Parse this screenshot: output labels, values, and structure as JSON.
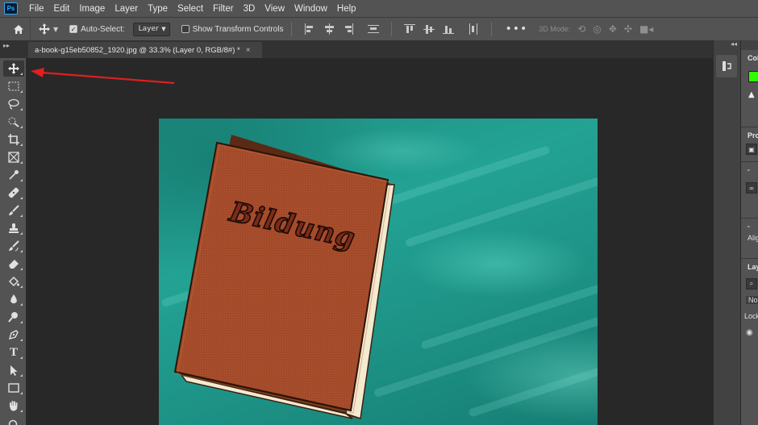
{
  "app": {
    "logo": "Ps"
  },
  "menu": [
    "File",
    "Edit",
    "Image",
    "Layer",
    "Type",
    "Select",
    "Filter",
    "3D",
    "View",
    "Window",
    "Help"
  ],
  "options": {
    "auto_select_label": "Auto-Select:",
    "auto_select_checked": true,
    "layer_select_value": "Layer",
    "show_transform_label": "Show Transform Controls",
    "more_label": "•••",
    "mode_3d_label": "3D Mode:"
  },
  "document": {
    "tab_title": "a-book-g15eb50852_1920.jpg @ 33.3% (Layer 0, RGB/8#) *",
    "close_label": "×"
  },
  "book_title": "Bildung",
  "tools": [
    "move-tool",
    "marquee-tool",
    "lasso-tool",
    "quick-selection-tool",
    "crop-tool",
    "frame-tool",
    "eyedropper-tool",
    "healing-brush-tool",
    "brush-tool",
    "clone-stamp-tool",
    "history-brush-tool",
    "eraser-tool",
    "paint-bucket-tool",
    "blur-tool",
    "dodge-tool",
    "pen-tool",
    "type-tool",
    "path-selection-tool",
    "rectangle-tool",
    "hand-tool",
    "zoom-tool"
  ],
  "right_panel": {
    "color_header": "Col",
    "properties_header": "Pro",
    "align_label": "Alig",
    "layers_header": "Lay",
    "blend_mode": "No",
    "lock_label": "Lock"
  },
  "colors": {
    "foreground": "#2eff00",
    "annotation_arrow": "#e01f1f",
    "book_cover": "#a24a2a"
  },
  "annotation": {
    "type": "arrow",
    "points_to": "move-tool"
  }
}
